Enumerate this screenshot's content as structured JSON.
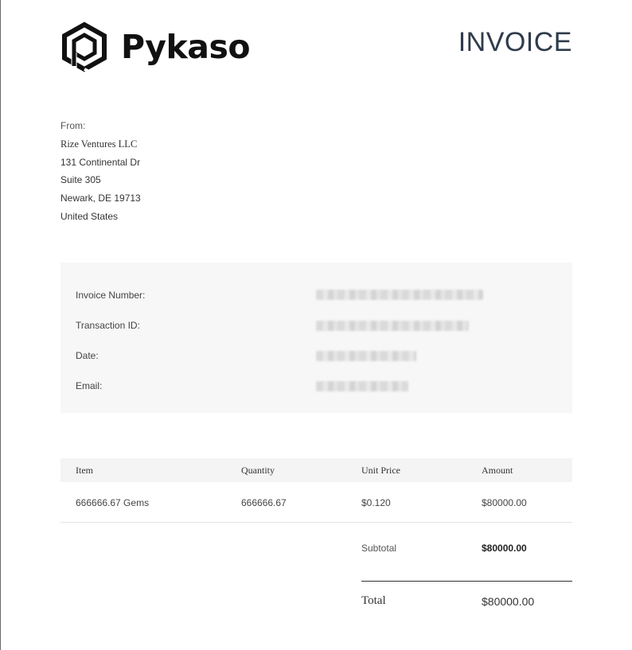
{
  "header": {
    "brand_name": "Pykaso",
    "logo_icon": "hexagon-p-logo-icon",
    "doc_title": "INVOICE"
  },
  "from": {
    "label": "From:",
    "lines": [
      "Rize Ventures LLC",
      "131 Continental Dr",
      "Suite 305",
      "Newark, DE 19713",
      "United States"
    ]
  },
  "details": {
    "rows": [
      {
        "label": "Invoice Number:",
        "value": ""
      },
      {
        "label": "Transaction ID:",
        "value": ""
      },
      {
        "label": "Date:",
        "value": ""
      },
      {
        "label": "Email:",
        "value": ""
      }
    ]
  },
  "items": {
    "headers": [
      "Item",
      "Quantity",
      "Unit Price",
      "Amount"
    ],
    "rows": [
      {
        "item": "666666.67 Gems",
        "quantity": "666666.67",
        "unit_price": "$0.120",
        "amount": "$80000.00"
      }
    ]
  },
  "totals": {
    "subtotal_label": "Subtotal",
    "subtotal_value": "$80000.00",
    "total_label": "Total",
    "total_value": "$80000.00"
  },
  "colors": {
    "title": "#2f3b4b",
    "panel_bg": "#f7f7f7",
    "brand": "#111111"
  }
}
